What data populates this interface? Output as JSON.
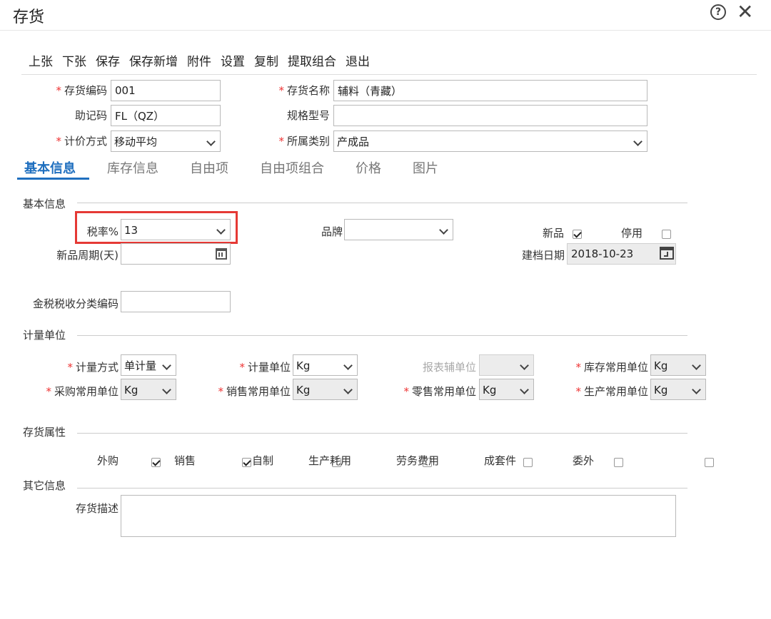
{
  "window": {
    "title": "存货"
  },
  "toolbar": {
    "items": [
      "上张",
      "下张",
      "保存",
      "保存新增",
      "附件",
      "设置",
      "复制",
      "提取组合",
      "退出"
    ]
  },
  "header_fields": {
    "code_label": "存货编码",
    "code_value": "001",
    "name_label": "存货名称",
    "name_value": "辅料（青藏）",
    "mnemonic_label": "助记码",
    "mnemonic_value": "FL（QZ）",
    "spec_label": "规格型号",
    "spec_value": "",
    "valuation_label": "计价方式",
    "valuation_value": "移动平均",
    "category_label": "所属类别",
    "category_value": "产成品"
  },
  "tabs": [
    "基本信息",
    "库存信息",
    "自由项",
    "自由项组合",
    "价格",
    "图片"
  ],
  "basic_info": {
    "section_title": "基本信息",
    "tax_rate_label": "税率%",
    "tax_rate_value": "13",
    "brand_label": "品牌",
    "brand_value": "",
    "new_product_label": "新品",
    "new_product_checked": true,
    "disabled_label": "停用",
    "disabled_checked": false,
    "new_period_label": "新品周期(天)",
    "new_period_value": "",
    "created_date_label": "建档日期",
    "created_date_value": "2018-10-23",
    "tax_class_label": "金税税收分类编码",
    "tax_class_value": ""
  },
  "units": {
    "section_title": "计量单位",
    "method_label": "计量方式",
    "method_value": "单计量",
    "unit_label": "计量单位",
    "unit_value": "Kg",
    "report_unit_label": "报表辅单位",
    "report_unit_value": "",
    "stock_unit_label": "库存常用单位",
    "stock_unit_value": "Kg",
    "purchase_unit_label": "采购常用单位",
    "purchase_unit_value": "Kg",
    "sales_unit_label": "销售常用单位",
    "sales_unit_value": "Kg",
    "retail_unit_label": "零售常用单位",
    "retail_unit_value": "Kg",
    "production_unit_label": "生产常用单位",
    "production_unit_value": "Kg"
  },
  "attributes": {
    "section_title": "存货属性",
    "items": [
      {
        "label": "外购",
        "checked": true
      },
      {
        "label": "销售",
        "checked": true
      },
      {
        "label": "自制",
        "checked": false
      },
      {
        "label": "生产耗用",
        "checked": false
      },
      {
        "label": "劳务费用",
        "checked": false
      },
      {
        "label": "成套件",
        "checked": false
      },
      {
        "label": "委外",
        "checked": false
      }
    ]
  },
  "other": {
    "section_title": "其它信息",
    "desc_label": "存货描述",
    "desc_value": ""
  }
}
